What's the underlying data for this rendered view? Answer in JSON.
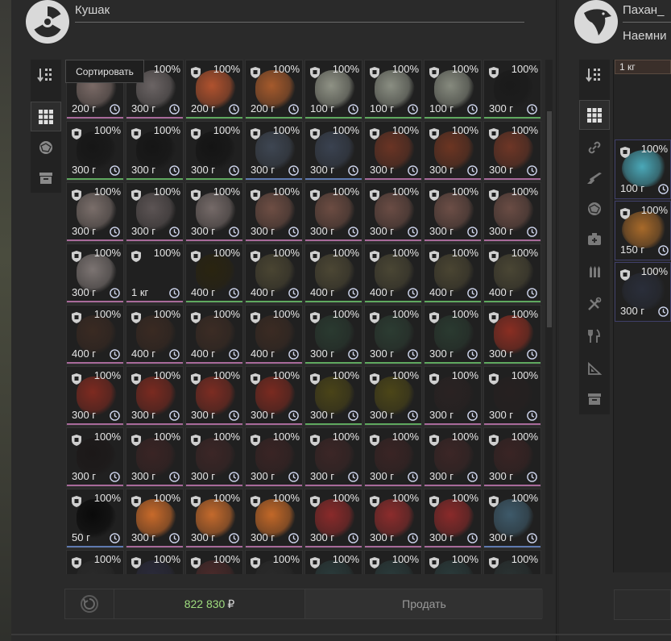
{
  "left_trader": {
    "name": "Кушак",
    "icon": "radiation-icon",
    "tooltip": "Сортировать",
    "money": "822 830",
    "currency": "₽",
    "sell_label": "Продать",
    "sidebar": [
      {
        "icon": "sort-icon"
      },
      {
        "icon": "grid-icon",
        "active": true
      },
      {
        "icon": "artifact-icon"
      },
      {
        "icon": "box-icon"
      }
    ],
    "grid": [
      [
        {
          "pct": "100%",
          "wt": "200 г",
          "c": "#7a6a66",
          "b": "#a86a9a"
        },
        {
          "pct": "100%",
          "wt": "300 г",
          "c": "#6b6464",
          "b": "#a86a9a"
        },
        {
          "pct": "100%",
          "wt": "200 г",
          "c": "#b0522e",
          "b": "#5fa85f"
        },
        {
          "pct": "100%",
          "wt": "200 г",
          "c": "#a55a2c",
          "b": "#5fa85f"
        },
        {
          "pct": "100%",
          "wt": "100 г",
          "c": "#8f9285",
          "b": "#5fa85f"
        },
        {
          "pct": "100%",
          "wt": "100 г",
          "c": "#8a8e82",
          "b": "#5fa85f"
        },
        {
          "pct": "100%",
          "wt": "100 г",
          "c": "#868a7e",
          "b": "#5fa85f"
        },
        {
          "pct": "100%",
          "wt": "300 г",
          "c": "#1a1a1a",
          "b": "#5fa85f"
        }
      ],
      [
        {
          "pct": "100%",
          "wt": "300 г",
          "c": "#161616",
          "b": "#5fa85f"
        },
        {
          "pct": "100%",
          "wt": "300 г",
          "c": "#151515",
          "b": "#5fa85f"
        },
        {
          "pct": "100%",
          "wt": "300 г",
          "c": "#141414",
          "b": "#5fa85f"
        },
        {
          "pct": "100%",
          "wt": "300 г",
          "c": "#3e4652",
          "b": "#5f7ab0"
        },
        {
          "pct": "100%",
          "wt": "300 г",
          "c": "#3a4250",
          "b": "#5f7ab0"
        },
        {
          "pct": "100%",
          "wt": "300 г",
          "c": "#6a3424",
          "b": "#a86a9a"
        },
        {
          "pct": "100%",
          "wt": "300 г",
          "c": "#6c3522",
          "b": "#a86a9a"
        },
        {
          "pct": "100%",
          "wt": "300 г",
          "c": "#6e3626",
          "b": "#a86a9a"
        }
      ],
      [
        {
          "pct": "100%",
          "wt": "300 г",
          "c": "#7a6e6a",
          "b": "#a86a9a"
        },
        {
          "pct": "100%",
          "wt": "300 г",
          "c": "#5c5454",
          "b": "#a86a9a"
        },
        {
          "pct": "100%",
          "wt": "300 г",
          "c": "#756a68",
          "b": "#a86a9a"
        },
        {
          "pct": "100%",
          "wt": "300 г",
          "c": "#6e4e44",
          "b": "#a86a9a"
        },
        {
          "pct": "100%",
          "wt": "300 г",
          "c": "#6c4c42",
          "b": "#a86a9a"
        },
        {
          "pct": "100%",
          "wt": "300 г",
          "c": "#6a4c44",
          "b": "#a86a9a"
        },
        {
          "pct": "100%",
          "wt": "300 г",
          "c": "#6c4e46",
          "b": "#a86a9a"
        },
        {
          "pct": "100%",
          "wt": "300 г",
          "c": "#6a4c44",
          "b": "#a86a9a"
        }
      ],
      [
        {
          "pct": "100%",
          "wt": "300 г",
          "c": "#7c7472",
          "b": "#a86a9a"
        },
        {
          "pct": "100%",
          "wt": "1 кг",
          "c": "#202020",
          "b": "#a86a9a"
        },
        {
          "pct": "100%",
          "wt": "400 г",
          "c": "#2a2410",
          "b": "#5fa85f"
        },
        {
          "pct": "100%",
          "wt": "400 г",
          "c": "#4a4532",
          "b": "#5fa85f"
        },
        {
          "pct": "100%",
          "wt": "400 г",
          "c": "#4c4734",
          "b": "#5fa85f"
        },
        {
          "pct": "100%",
          "wt": "400 г",
          "c": "#4a4634",
          "b": "#5fa85f"
        },
        {
          "pct": "100%",
          "wt": "400 г",
          "c": "#4a4532",
          "b": "#5fa85f"
        },
        {
          "pct": "100%",
          "wt": "400 г",
          "c": "#4a4634",
          "b": "#5fa85f"
        }
      ],
      [
        {
          "pct": "100%",
          "wt": "400 г",
          "c": "#3a2a22",
          "b": "#a86a9a"
        },
        {
          "pct": "100%",
          "wt": "400 г",
          "c": "#3a2a22",
          "b": "#a86a9a"
        },
        {
          "pct": "100%",
          "wt": "400 г",
          "c": "#3c2c24",
          "b": "#a86a9a"
        },
        {
          "pct": "100%",
          "wt": "400 г",
          "c": "#3b2b23",
          "b": "#a86a9a"
        },
        {
          "pct": "100%",
          "wt": "300 г",
          "c": "#2a3a30",
          "b": "#5fa85f"
        },
        {
          "pct": "100%",
          "wt": "300 г",
          "c": "#2c3c32",
          "b": "#5fa85f"
        },
        {
          "pct": "100%",
          "wt": "300 г",
          "c": "#2a3a30",
          "b": "#5fa85f"
        },
        {
          "pct": "100%",
          "wt": "300 г",
          "c": "#8a2e22",
          "b": "#5fa85f"
        }
      ],
      [
        {
          "pct": "100%",
          "wt": "300 г",
          "c": "#7e2a20",
          "b": "#a86a9a"
        },
        {
          "pct": "100%",
          "wt": "300 г",
          "c": "#7a2a20",
          "b": "#a86a9a"
        },
        {
          "pct": "100%",
          "wt": "300 г",
          "c": "#7c2c22",
          "b": "#a86a9a"
        },
        {
          "pct": "100%",
          "wt": "300 г",
          "c": "#7a2a20",
          "b": "#a86a9a"
        },
        {
          "pct": "100%",
          "wt": "300 г",
          "c": "#4a4418",
          "b": "#5fa85f"
        },
        {
          "pct": "100%",
          "wt": "300 г",
          "c": "#4c4618",
          "b": "#5fa85f"
        },
        {
          "pct": "100%",
          "wt": "300 г",
          "c": "#2a2222",
          "b": "#a86a9a"
        },
        {
          "pct": "100%",
          "wt": "300 г",
          "c": "#262020",
          "b": "#a86a9a"
        }
      ],
      [
        {
          "pct": "100%",
          "wt": "300 г",
          "c": "#1c1818",
          "b": "#a86a9a"
        },
        {
          "pct": "100%",
          "wt": "300 г",
          "c": "#3a2424",
          "b": "#a86a9a"
        },
        {
          "pct": "100%",
          "wt": "300 г",
          "c": "#3c2626",
          "b": "#a86a9a"
        },
        {
          "pct": "100%",
          "wt": "300 г",
          "c": "#3a2424",
          "b": "#a86a9a"
        },
        {
          "pct": "100%",
          "wt": "300 г",
          "c": "#3c2626",
          "b": "#a86a9a"
        },
        {
          "pct": "100%",
          "wt": "300 г",
          "c": "#3a2424",
          "b": "#a86a9a"
        },
        {
          "pct": "100%",
          "wt": "300 г",
          "c": "#3c2626",
          "b": "#a86a9a"
        },
        {
          "pct": "100%",
          "wt": "300 г",
          "c": "#3a2424",
          "b": "#a86a9a"
        }
      ],
      [
        {
          "pct": "100%",
          "wt": "50 г",
          "c": "#0a0a0a",
          "b": "#5f7ab0"
        },
        {
          "pct": "100%",
          "wt": "300 г",
          "c": "#c86a2a",
          "b": "#a86a9a"
        },
        {
          "pct": "100%",
          "wt": "300 г",
          "c": "#c46a2c",
          "b": "#a86a9a"
        },
        {
          "pct": "100%",
          "wt": "300 г",
          "c": "#c26828",
          "b": "#a86a9a"
        },
        {
          "pct": "100%",
          "wt": "300 г",
          "c": "#8a2a2a",
          "b": "#a86a9a"
        },
        {
          "pct": "100%",
          "wt": "300 г",
          "c": "#8c2c2c",
          "b": "#a86a9a"
        },
        {
          "pct": "100%",
          "wt": "300 г",
          "c": "#8a2a2a",
          "b": "#a86a9a"
        },
        {
          "pct": "100%",
          "wt": "300 г",
          "c": "#3e5a6a",
          "b": "#5f7ab0"
        }
      ],
      [
        {
          "pct": "100%",
          "wt": "",
          "c": "#2a2a2a",
          "b": "#a86a9a"
        },
        {
          "pct": "100%",
          "wt": "",
          "c": "#2a2a3a",
          "b": "#a86a9a"
        },
        {
          "pct": "100%",
          "wt": "",
          "c": "#4a2a2a",
          "b": "#a86a9a"
        },
        {
          "pct": "100%",
          "wt": "",
          "c": "#2a2a2a",
          "b": "#a86a9a"
        },
        {
          "pct": "100%",
          "wt": "",
          "c": "#2a3a3a",
          "b": "#a86a9a"
        },
        {
          "pct": "100%",
          "wt": "",
          "c": "#2a3a3a",
          "b": "#a86a9a"
        },
        {
          "pct": "100%",
          "wt": "",
          "c": "#2a3a3a",
          "b": "#a86a9a"
        },
        {
          "pct": "100%",
          "wt": "",
          "c": "#2a3232",
          "b": "#a86a9a"
        }
      ]
    ]
  },
  "right_trader": {
    "name": "Пахан_",
    "subtitle": "Наемни",
    "icon": "eagle-icon",
    "top_item_weight": "1 кг",
    "sidebar": [
      {
        "icon": "sort-icon"
      },
      {
        "icon": "grid-icon",
        "active": true
      },
      {
        "icon": "link-icon"
      },
      {
        "icon": "rifle-icon"
      },
      {
        "icon": "artifact-icon"
      },
      {
        "icon": "medkit-icon"
      },
      {
        "icon": "ammo-icon"
      },
      {
        "icon": "tools-icon"
      },
      {
        "icon": "food-icon"
      },
      {
        "icon": "blueprint-icon"
      },
      {
        "icon": "box-icon"
      }
    ],
    "items": [
      {
        "pct": "100%",
        "wt": "100 г",
        "c": "#4aa8b8"
      },
      {
        "pct": "100%",
        "wt": "150 г",
        "c": "#a86a2a"
      },
      {
        "pct": "100%",
        "wt": "300 г",
        "c": "#2a2e3a"
      }
    ]
  }
}
